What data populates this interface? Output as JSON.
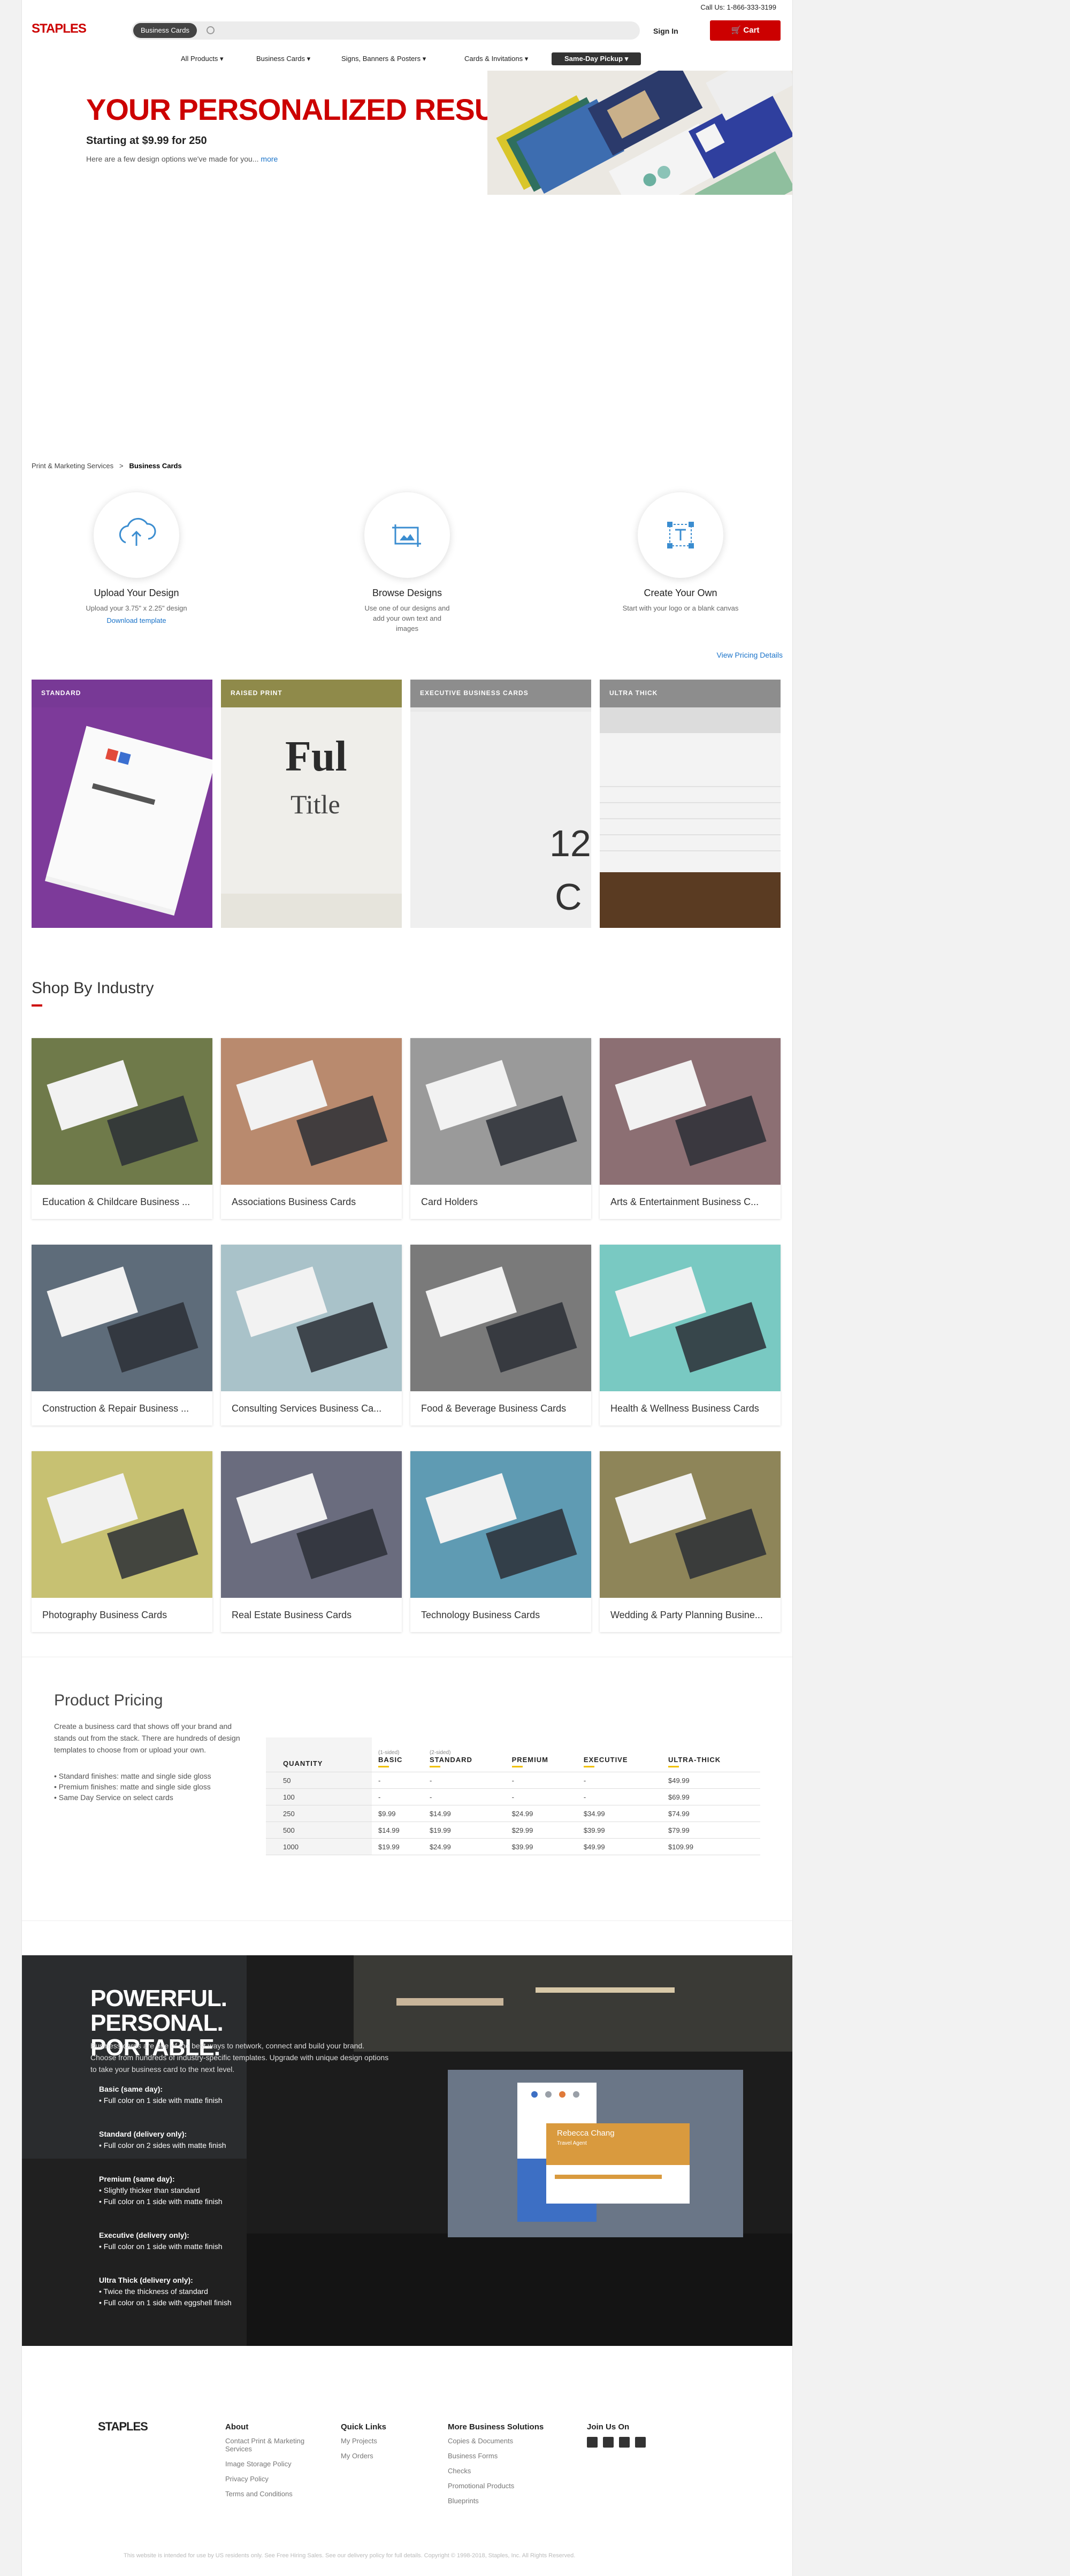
{
  "header": {
    "call_us": "Call Us: 1-866-333-3199",
    "logo": "STAPLES",
    "search_chip": "Business Cards",
    "sign_in": "Sign In",
    "cart": "Cart",
    "nav": [
      "All Products ▾",
      "Business Cards ▾",
      "Signs, Banners & Posters ▾",
      "Cards & Invitations ▾",
      "Same-Day Pickup ▾"
    ]
  },
  "hero": {
    "title": "YOUR PERSONALIZED RESULTS",
    "subtitle": "Starting at $9.99 for 250",
    "desc": "Here are a few design options we've made for you...",
    "more": "more"
  },
  "breadcrumb": {
    "parent": "Print & Marketing Services",
    "sep": ">",
    "current": "Business Cards"
  },
  "options": [
    {
      "title": "Upload Your Design",
      "desc": "Upload your 3.75\" x 2.25\" design",
      "link": "Download template",
      "icon": "upload-cloud-icon"
    },
    {
      "title": "Browse Designs",
      "desc": "Use one of our designs and add your own text and images",
      "link": "",
      "icon": "browse-designs-icon"
    },
    {
      "title": "Create Your Own",
      "desc": "Start with your logo or a blank canvas",
      "link": "",
      "icon": "create-own-icon"
    }
  ],
  "pricing_link": "View Pricing Details",
  "finishes": [
    {
      "label": "STANDARD",
      "bar": "#7a3e94"
    },
    {
      "label": "RAISED PRINT",
      "bar": "#8f8a4a"
    },
    {
      "label": "EXECUTIVE BUSINESS CARDS",
      "bar": "#8d8d8d"
    },
    {
      "label": "ULTRA THICK",
      "bar": "#8d8d8d"
    }
  ],
  "industry": {
    "title": "Shop By Industry",
    "tiles": [
      {
        "label": "Education & Childcare Business ...",
        "bg": "#6f7a4a"
      },
      {
        "label": "Associations Business Cards",
        "bg": "#b98a6e"
      },
      {
        "label": "Card Holders",
        "bg": "#9a9a9a"
      },
      {
        "label": "Arts & Entertainment Business C...",
        "bg": "#8c6f73"
      },
      {
        "label": "Construction & Repair Business ...",
        "bg": "#5e6c7a"
      },
      {
        "label": "Consulting Services Business Ca...",
        "bg": "#a9c2c9"
      },
      {
        "label": "Food & Beverage Business Cards",
        "bg": "#7a7a7a"
      },
      {
        "label": "Health & Wellness Business Cards",
        "bg": "#79c9c2"
      },
      {
        "label": "Photography Business Cards",
        "bg": "#c7c172"
      },
      {
        "label": "Real Estate Business Cards",
        "bg": "#6a6c7e"
      },
      {
        "label": "Technology Business Cards",
        "bg": "#5f9bb3"
      },
      {
        "label": "Wedding & Party Planning Busine...",
        "bg": "#8e8559"
      }
    ]
  },
  "product_pricing": {
    "title": "Product Pricing",
    "desc": "Create a business card that shows off your brand and stands out from the stack. There are hundreds of design templates to choose from or upload your own.",
    "bullets": [
      "• Standard finishes: matte and single side gloss",
      "• Premium finishes: matte and single side gloss",
      "• Same Day Service on select cards"
    ],
    "columns": [
      {
        "sub": "",
        "label": "QUANTITY"
      },
      {
        "sub": "(1-sided)",
        "label": "BASIC"
      },
      {
        "sub": "(2-sided)",
        "label": "STANDARD"
      },
      {
        "sub": "",
        "label": "PREMIUM"
      },
      {
        "sub": "",
        "label": "EXECUTIVE"
      },
      {
        "sub": "",
        "label": "ULTRA-THICK"
      }
    ],
    "rows": [
      [
        "50",
        "-",
        "-",
        "-",
        "-",
        "$49.99"
      ],
      [
        "100",
        "-",
        "-",
        "-",
        "-",
        "$69.99"
      ],
      [
        "250",
        "$9.99",
        "$14.99",
        "$24.99",
        "$34.99",
        "$74.99"
      ],
      [
        "500",
        "$14.99",
        "$19.99",
        "$29.99",
        "$39.99",
        "$79.99"
      ],
      [
        "1000",
        "$19.99",
        "$24.99",
        "$39.99",
        "$49.99",
        "$109.99"
      ]
    ]
  },
  "powerful": {
    "title": "POWERFUL. PERSONAL. PORTABLE.",
    "desc": "Business cards are one of the best ways to network, connect and build your brand. Choose from hundreds of industry-specific templates. Upgrade with unique design options to take your business card to the next level.",
    "items": [
      {
        "title": "Basic (same day):",
        "lines": [
          "Full color on 1 side with matte finish"
        ]
      },
      {
        "title": "Standard (delivery only):",
        "lines": [
          "Full color on 2 sides with matte finish"
        ]
      },
      {
        "title": "Premium (same day):",
        "lines": [
          "Slightly thicker than standard",
          "Full color on 1 side with matte finish"
        ]
      },
      {
        "title": "Executive (delivery only):",
        "lines": [
          "Full color on 1 side with matte finish"
        ]
      },
      {
        "title": "Ultra Thick (delivery only):",
        "lines": [
          "Twice the thickness of standard",
          "Full color on 1 side with eggshell finish"
        ]
      }
    ],
    "card_name": "Rebecca Chang",
    "card_role": "Travel Agent"
  },
  "footer": {
    "logo": "STAPLES",
    "about": {
      "title": "About",
      "links": [
        "Contact Print & Marketing Services",
        "Image Storage Policy",
        "Privacy Policy",
        "Terms and Conditions"
      ]
    },
    "quick": {
      "title": "Quick Links",
      "links": [
        "My Projects",
        "My Orders"
      ]
    },
    "more": {
      "title": "More Business Solutions",
      "links": [
        "Copies & Documents",
        "Business Forms",
        "Checks",
        "Promotional Products",
        "Blueprints"
      ]
    },
    "join": {
      "title": "Join Us On"
    },
    "copyright": "This website is intended for use by US residents only. See Free Hiring Sales. See our delivery policy for full details. Copyright © 1998-2018, Staples, Inc. All Rights Reserved."
  }
}
